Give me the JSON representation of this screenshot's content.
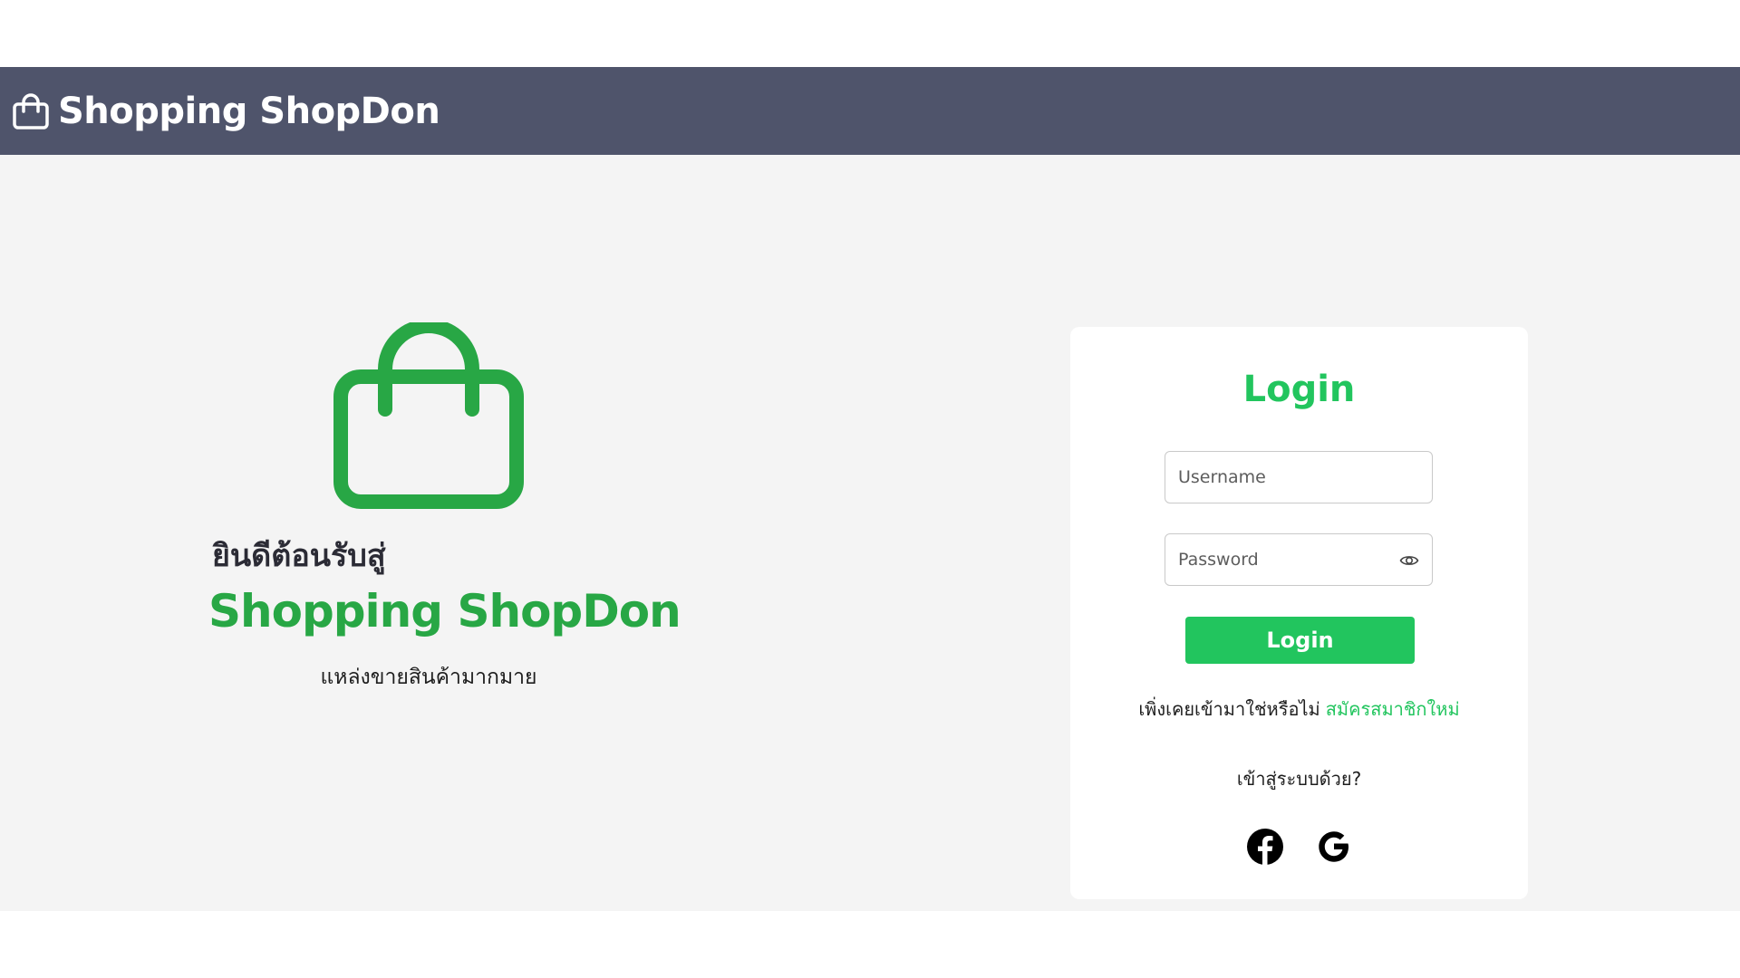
{
  "navbar": {
    "brand_label": "Shopping ShopDon",
    "brand_icon": "shopping-bag-icon",
    "background": "#4f546b"
  },
  "hero": {
    "icon": "shopping-bag-icon",
    "welcome": "ยินดีต้อนรับสู่",
    "title": "Shopping ShopDon",
    "subtitle": "แหล่งขายสินค้ามากมาย",
    "accent": "#28a745"
  },
  "login": {
    "title": "Login",
    "username_placeholder": "Username",
    "password_placeholder": "Password",
    "password_toggle_icon": "eye-icon",
    "submit_label": "Login",
    "signup_prompt": "เพิ่งเคยเข้ามาใช่หรือไม่",
    "signup_link": "สมัครสมาชิกใหม่",
    "social_prompt": "เข้าสู่ระบบด้วย?",
    "social": [
      {
        "icon": "facebook-icon"
      },
      {
        "icon": "google-icon"
      }
    ],
    "accent": "#22c55e"
  }
}
